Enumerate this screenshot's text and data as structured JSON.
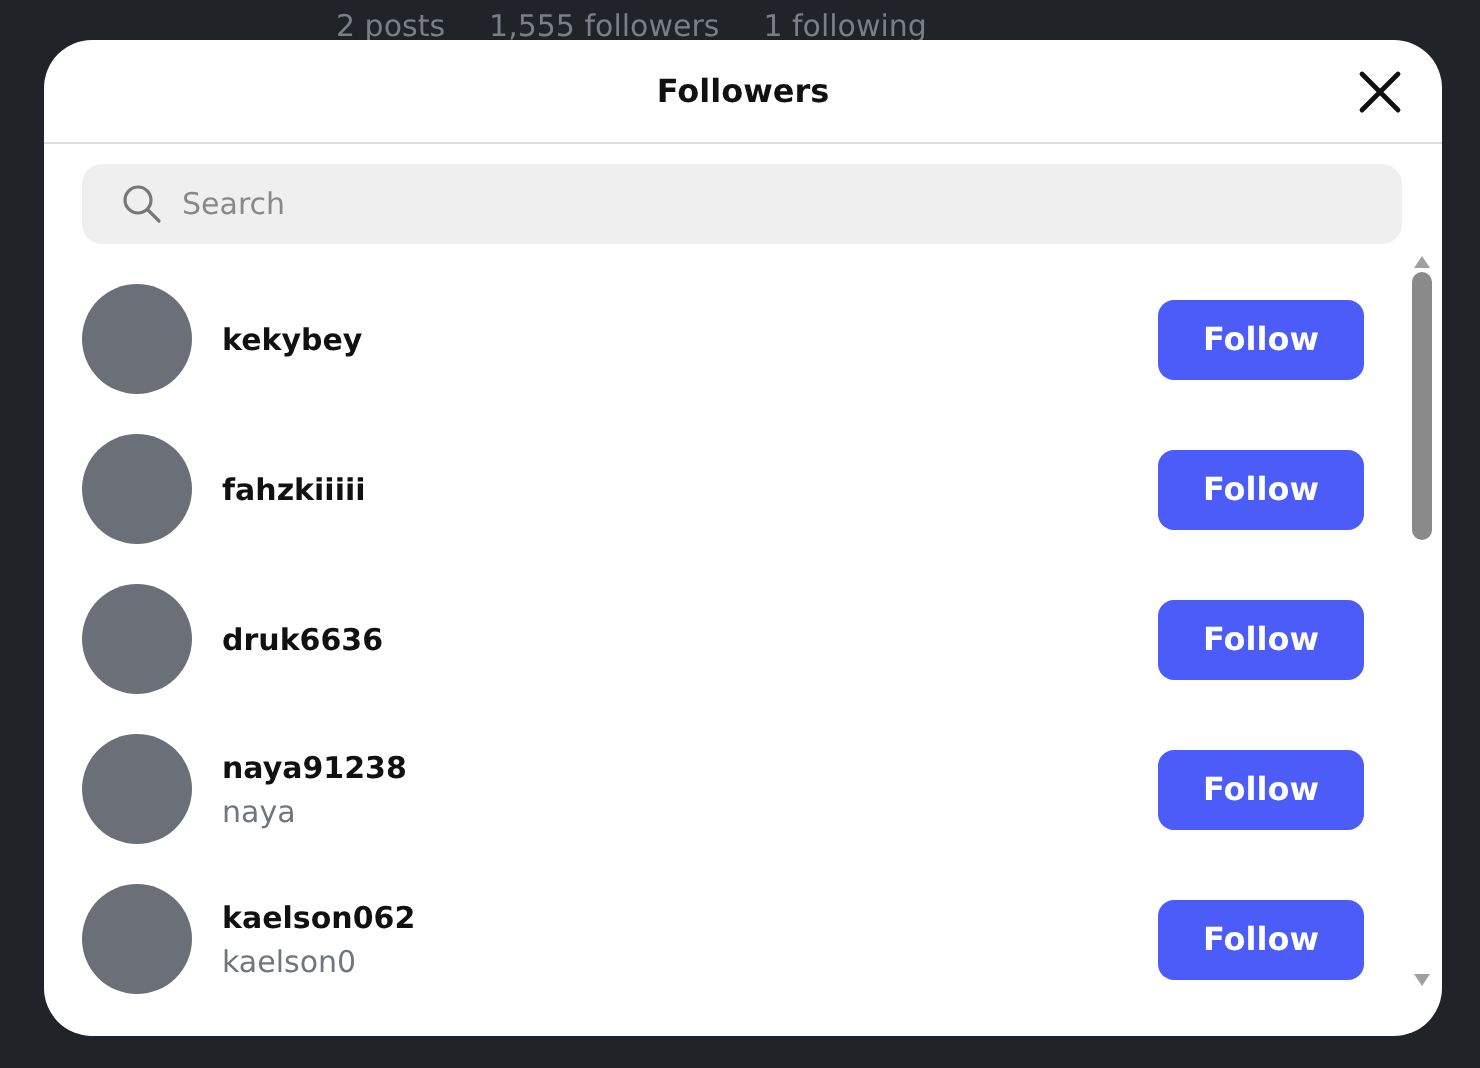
{
  "background_stats": [
    "2 posts",
    "1,555 followers",
    "1 following"
  ],
  "dialog": {
    "title": "Followers",
    "search": {
      "placeholder": "Search"
    },
    "followers": [
      {
        "username": "kekybey",
        "button": "Follow"
      },
      {
        "username": "fahzkiiiii",
        "button": "Follow"
      },
      {
        "username": "druk6636",
        "button": "Follow"
      },
      {
        "username": "naya91238",
        "name": "naya",
        "button": "Follow"
      },
      {
        "username": "kaelson062",
        "name": "kaelson0",
        "button": "Follow"
      }
    ]
  }
}
